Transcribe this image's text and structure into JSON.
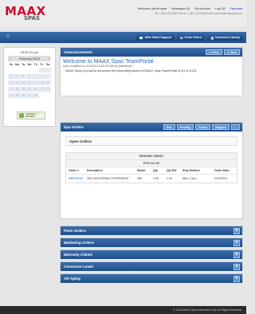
{
  "brand": {
    "logo": "MAAX",
    "logo_sub": "SPAS"
  },
  "header": {
    "welcome": "Welcome: jsmall spas",
    "messages": "Messages (0)",
    "my_account": "My Account",
    "logoff": "Log Off",
    "lang": "Français",
    "contact": "Tel: 1-800-123-4567  Service: 1-800-123-4568  Email: service@maaxspas.com"
  },
  "nav": {
    "home_icon": "home-icon",
    "buttons": [
      "After Sales Support",
      "Order Online",
      "Document Library"
    ]
  },
  "calendar": {
    "time": "04:51:01 pm",
    "month": "February 2013",
    "prev": "‹",
    "next": "›",
    "days": [
      "Su",
      "Mo",
      "Tu",
      "We",
      "Th",
      "Fr",
      "Sa"
    ],
    "dates": [
      "",
      "",
      "",
      "",
      "",
      "1",
      "2",
      "3",
      "4",
      "5",
      "6",
      "7",
      "8",
      "9",
      "10",
      "11",
      "12",
      "13",
      "14",
      "15",
      "16",
      "17",
      "18",
      "19",
      "20",
      "21",
      "22",
      "23",
      "24",
      "25",
      "26",
      "27",
      "28"
    ],
    "badge": "VERIFIED & SECURED"
  },
  "announcements": {
    "label": "Announcements",
    "prev": "<< Prev",
    "next": ">> Next",
    "title": "Welcome to MAAX Spas TeamPortal",
    "modified": "Last modified on 2/1/2013 9:02:00 AM by jbauffman",
    "text": "MAAX Spas is proud to announce the impending launch of MAAX Spas TeamPortal in Q1 of 2013."
  },
  "spa_orders": {
    "label": "Spa Orders",
    "buttons": [
      "New",
      "Pending",
      "Closed",
      "Shipped"
    ],
    "open_orders": "Open Orders",
    "pending_credit": "PENDING CREDIT",
    "poh": "POH CO-OP",
    "columns": [
      "Order #",
      "Description",
      "Model",
      "Qty",
      "Qty BO",
      "Ship Method",
      "Order Date"
    ],
    "rows": [
      [
        "MBR35153",
        "280 CALIFORNIA COOPERAGE",
        "280",
        "1.00",
        "1.00",
        "WILL CALL",
        "2/22/2013"
      ]
    ]
  },
  "sections": [
    "Parts Orders",
    "Marketing Orders",
    "Warranty Claims",
    "Consumer Leads",
    "AR Aging"
  ],
  "footer": "© 2013 MAAX Spas Industries Corp. All Rights Reserved."
}
